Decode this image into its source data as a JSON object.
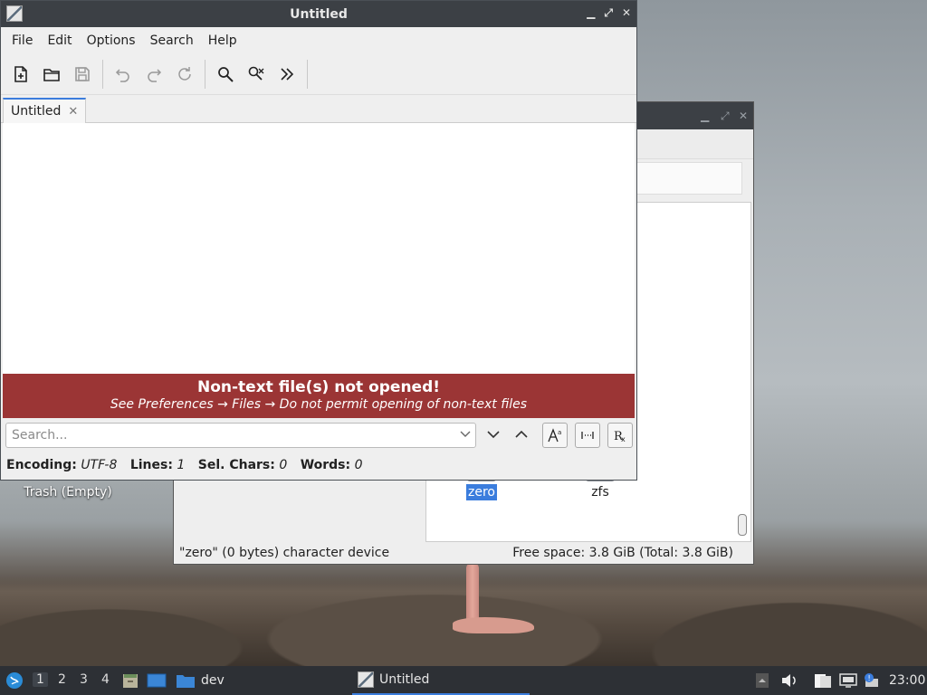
{
  "desktop": {
    "trash_label": "Trash (Empty)"
  },
  "file_manager": {
    "files": [
      {
        "name": "zero",
        "selected": true
      },
      {
        "name": "zfs",
        "selected": false
      }
    ],
    "status_left": "\"zero\" (0 bytes) character device",
    "status_right": "Free space: 3.8 GiB (Total: 3.8 GiB)"
  },
  "editor": {
    "title": "Untitled",
    "menu": [
      "File",
      "Edit",
      "Options",
      "Search",
      "Help"
    ],
    "toolbar_icons": [
      "new-file-icon",
      "open-folder-icon",
      "save-icon",
      "undo-icon",
      "redo-icon",
      "reload-icon",
      "find-icon",
      "find-replace-icon",
      "more-icon"
    ],
    "tab_label": "Untitled",
    "banner_title": "Non-text file(s) not opened!",
    "banner_subtitle": "See Preferences → Files → Do not permit opening of non-text files",
    "search_placeholder": "Search...",
    "status": {
      "encoding_label": "Encoding:",
      "encoding_value": "UTF-8",
      "lines_label": "Lines:",
      "lines_value": "1",
      "sel_label": "Sel. Chars:",
      "sel_value": "0",
      "words_label": "Words:",
      "words_value": "0"
    }
  },
  "taskbar": {
    "desktops": [
      "1",
      "2",
      "3",
      "4"
    ],
    "folder_label": "dev",
    "active_task": "Untitled",
    "clock": "23:00"
  },
  "colors": {
    "accent": "#3b7ddd",
    "banner": "#9b3535",
    "titlebar": "#3c4045",
    "taskbar": "#2d3035"
  }
}
